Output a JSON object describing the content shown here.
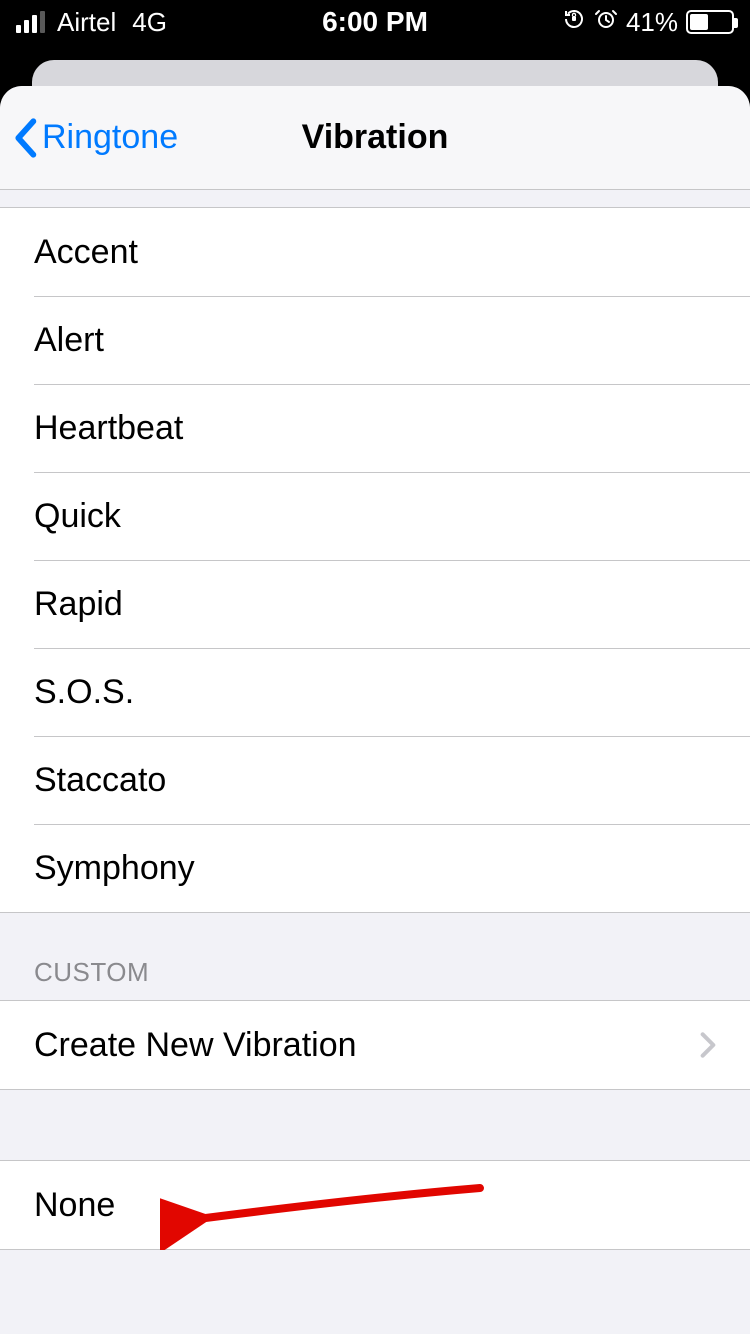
{
  "status": {
    "carrier": "Airtel",
    "network": "4G",
    "time": "6:00 PM",
    "battery_pct": "41%"
  },
  "nav": {
    "back_label": "Ringtone",
    "title": "Vibration"
  },
  "standard": {
    "items": [
      "Accent",
      "Alert",
      "Heartbeat",
      "Quick",
      "Rapid",
      "S.O.S.",
      "Staccato",
      "Symphony"
    ]
  },
  "custom": {
    "header": "CUSTOM",
    "create_label": "Create New Vibration"
  },
  "none": {
    "label": "None"
  }
}
